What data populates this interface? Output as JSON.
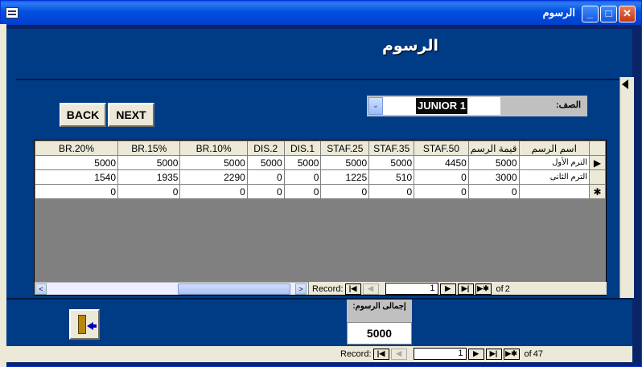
{
  "window": {
    "title": "الرسوم"
  },
  "form": {
    "title": "الرسوم"
  },
  "buttons": {
    "back": "BACK",
    "next": "NEXT"
  },
  "class_selector": {
    "label": "الصف:",
    "value": "JUNIOR 1"
  },
  "grid": {
    "columns": [
      "BR.20%",
      "BR.15%",
      "BR.10%",
      "DIS.2",
      "DIS.1",
      "STAF.25",
      "STAF.35",
      "STAF.50",
      "قيمة الرسم",
      "اسم الرسم"
    ],
    "rows": [
      [
        "5000",
        "5000",
        "5000",
        "5000",
        "5000",
        "5000",
        "5000",
        "4450",
        "5000",
        "الترم الأول"
      ],
      [
        "1540",
        "1935",
        "2290",
        "0",
        "0",
        "1225",
        "510",
        "0",
        "3000",
        "الترم الثانى"
      ],
      [
        "0",
        "0",
        "0",
        "0",
        "0",
        "0",
        "0",
        "0",
        "0",
        ""
      ]
    ],
    "selectors": [
      "▶",
      "",
      "✱"
    ],
    "nav": {
      "label": "Record:",
      "current": "1",
      "of": "of",
      "total": "2"
    }
  },
  "total": {
    "label": "إجمالى الرسوم:",
    "value": "5000"
  },
  "form_nav": {
    "label": "Record:",
    "current": "1",
    "of": "of",
    "total": "47"
  },
  "icons": [
    "app-icon",
    "minimize-icon",
    "maximize-icon",
    "close-icon",
    "dropdown-arrow-icon",
    "exit-door-icon",
    "record-selector-icon"
  ]
}
